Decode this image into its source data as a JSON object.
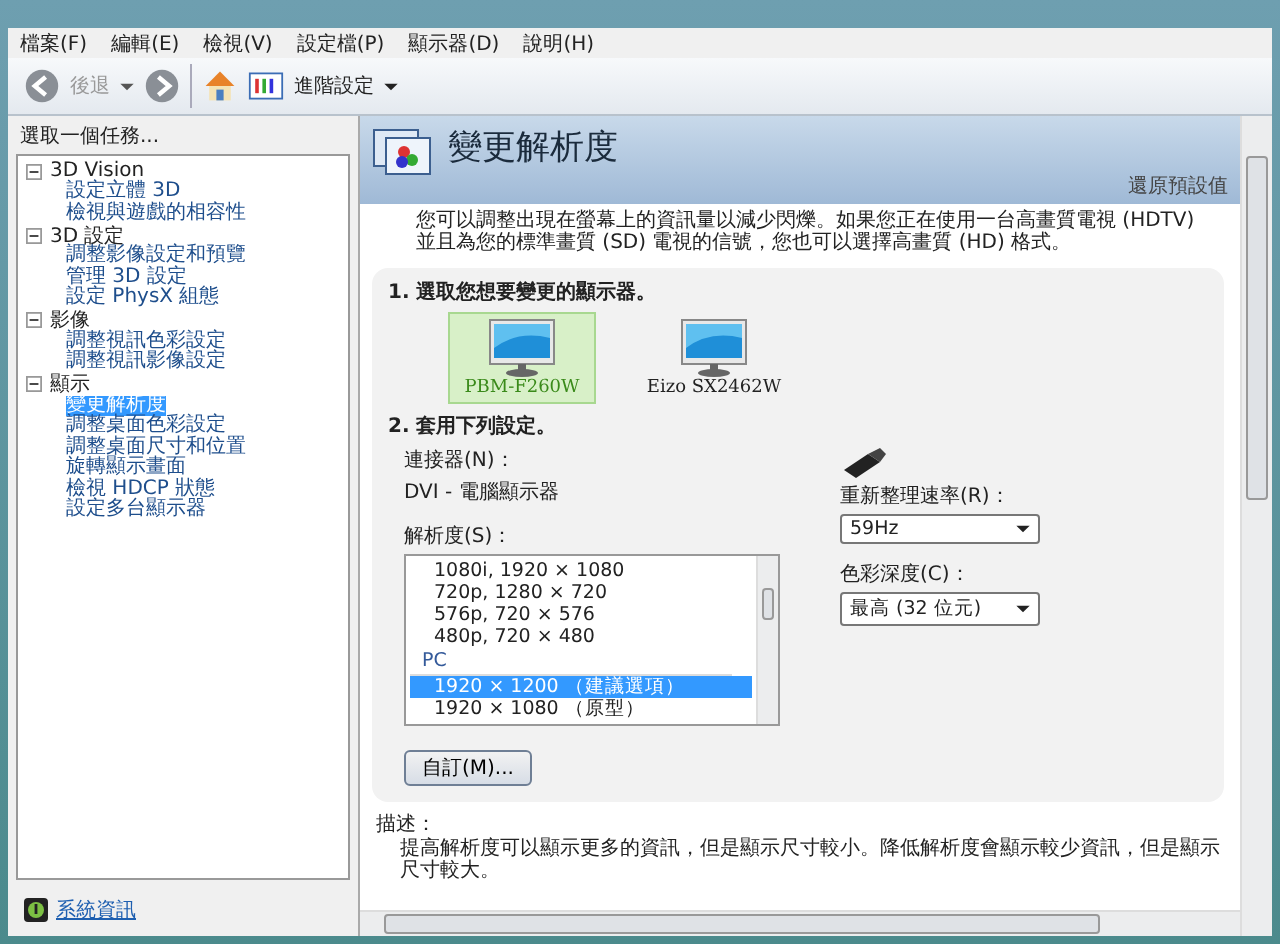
{
  "menu": [
    {
      "label": "檔案(F)"
    },
    {
      "label": "編輯(E)"
    },
    {
      "label": "檢視(V)"
    },
    {
      "label": "設定檔(P)"
    },
    {
      "label": "顯示器(D)"
    },
    {
      "label": "說明(H)"
    }
  ],
  "toolbar": {
    "back": "後退",
    "advanced": "進階設定"
  },
  "sidebar": {
    "title": "選取一個任務...",
    "tree": [
      {
        "label": "3D Vision",
        "expanded": true,
        "children": [
          {
            "label": "設定立體 3D",
            "selected": false
          },
          {
            "label": "檢視與遊戲的相容性",
            "selected": false
          }
        ]
      },
      {
        "label": "3D 設定",
        "expanded": true,
        "children": [
          {
            "label": "調整影像設定和預覽",
            "selected": false
          },
          {
            "label": "管理 3D 設定",
            "selected": false
          },
          {
            "label": "設定 PhysX 組態",
            "selected": false
          }
        ]
      },
      {
        "label": "影像",
        "expanded": true,
        "children": [
          {
            "label": "調整視訊色彩設定",
            "selected": false
          },
          {
            "label": "調整視訊影像設定",
            "selected": false
          }
        ]
      },
      {
        "label": "顯示",
        "expanded": true,
        "children": [
          {
            "label": "變更解析度",
            "selected": true
          },
          {
            "label": "調整桌面色彩設定",
            "selected": false
          },
          {
            "label": "調整桌面尺寸和位置",
            "selected": false
          },
          {
            "label": "旋轉顯示畫面",
            "selected": false
          },
          {
            "label": "檢視 HDCP 狀態",
            "selected": false
          },
          {
            "label": "設定多台顯示器",
            "selected": false
          }
        ]
      }
    ],
    "system_info": "系統資訊"
  },
  "page": {
    "title": "變更解析度",
    "restore": "還原預設值",
    "intro": "您可以調整出現在螢幕上的資訊量以減少閃爍。如果您正在使用一台高畫質電視 (HDTV) 並且為您的標準畫質 (SD) 電視的信號，您也可以選擇高畫質 (HD) 格式。",
    "section1": "1. 選取您想要變更的顯示器。",
    "displays": [
      {
        "name": "PBM-F260W",
        "selected": true
      },
      {
        "name": "Eizo SX2462W",
        "selected": false
      }
    ],
    "section2": "2. 套用下列設定。",
    "connector_label": "連接器(N)：",
    "connector": "DVI - 電腦顯示器",
    "resolution_label": "解析度(S)：",
    "resolutions": [
      {
        "kind": "item",
        "label": "1080i, 1920 × 1080",
        "selected": false
      },
      {
        "kind": "item",
        "label": "720p, 1280 × 720",
        "selected": false
      },
      {
        "kind": "item",
        "label": "576p, 720 × 576",
        "selected": false
      },
      {
        "kind": "item",
        "label": "480p, 720 × 480",
        "selected": false
      },
      {
        "kind": "group",
        "label": "PC"
      },
      {
        "kind": "item",
        "label": "1920 × 1200 （建議選項）",
        "selected": true
      },
      {
        "kind": "item",
        "label": "1920 × 1080 （原型）",
        "selected": false
      }
    ],
    "refresh_label": "重新整理速率(R)：",
    "refresh": "59Hz",
    "depth_label": "色彩深度(C)：",
    "depth": "最高 (32 位元)",
    "custom_button": "自訂(M)...",
    "description_label": "描述：",
    "description": "提高解析度可以顯示更多的資訊，但是顯示尺寸較小。降低解析度會顯示較少資訊，但是顯示尺寸較大。"
  }
}
